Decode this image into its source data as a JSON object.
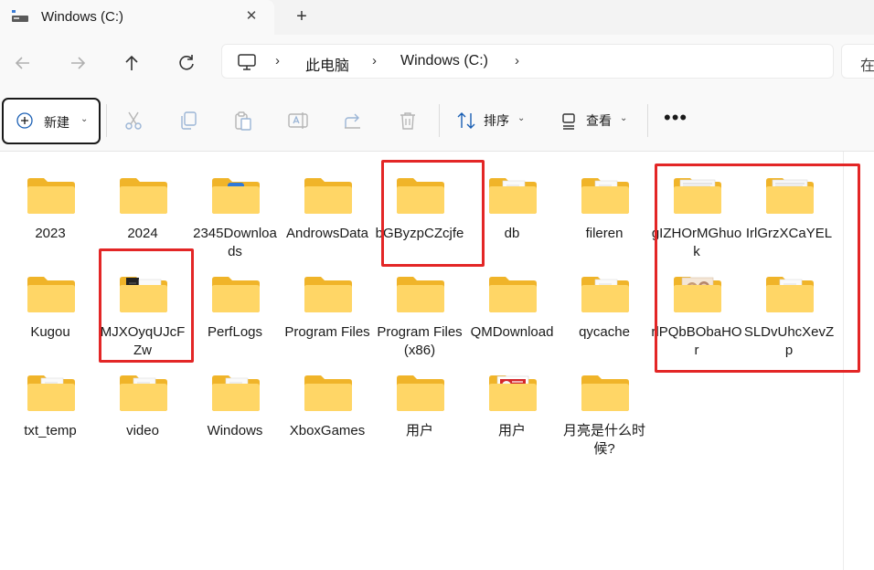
{
  "tab": {
    "title": "Windows (C:)",
    "icon": "drive-icon",
    "close": "✕",
    "new_tab": "+"
  },
  "address": {
    "crumbs": [
      "此电脑",
      "Windows (C:)"
    ],
    "search_placeholder": "在"
  },
  "toolbar": {
    "new_label": "新建",
    "sort_label": "排序",
    "view_label": "查看",
    "more_label": "•••"
  },
  "items": [
    {
      "name": "2023",
      "thumb": "none"
    },
    {
      "name": "2024",
      "thumb": "none"
    },
    {
      "name": "2345Downloads",
      "thumb": "blue-app"
    },
    {
      "name": "AndrowsData",
      "thumb": "none"
    },
    {
      "name": "bGByzpCZcjfe",
      "thumb": "none"
    },
    {
      "name": "db",
      "thumb": "paper"
    },
    {
      "name": "fileren",
      "thumb": "paper"
    },
    {
      "name": "gIZHOrMGhuok",
      "thumb": "doc"
    },
    {
      "name": "IrlGrzXCaYEL",
      "thumb": "doc"
    },
    {
      "name": "Kugou",
      "thumb": "none"
    },
    {
      "name": "MJXOyqUJcFZw",
      "thumb": "dark"
    },
    {
      "name": "PerfLogs",
      "thumb": "none"
    },
    {
      "name": "Program Files",
      "thumb": "none"
    },
    {
      "name": "Program Files (x86)",
      "thumb": "none"
    },
    {
      "name": "QMDownload",
      "thumb": "none"
    },
    {
      "name": "qycache",
      "thumb": "paper"
    },
    {
      "name": "rlPQbBObaHOr",
      "thumb": "face"
    },
    {
      "name": "SLDvUhcXevZp",
      "thumb": "paper"
    },
    {
      "name": "txt_temp",
      "thumb": "paper"
    },
    {
      "name": "video",
      "thumb": "paper"
    },
    {
      "name": "Windows",
      "thumb": "paper"
    },
    {
      "name": "XboxGames",
      "thumb": "none"
    },
    {
      "name": "用户",
      "thumb": "none"
    },
    {
      "name": "用户",
      "thumb": "red-img"
    },
    {
      "name": "月亮是什么时候?",
      "thumb": "none"
    }
  ],
  "colors": {
    "folder_back": "#f0b429",
    "folder_front": "#ffd666",
    "highlight": "#e32626"
  }
}
